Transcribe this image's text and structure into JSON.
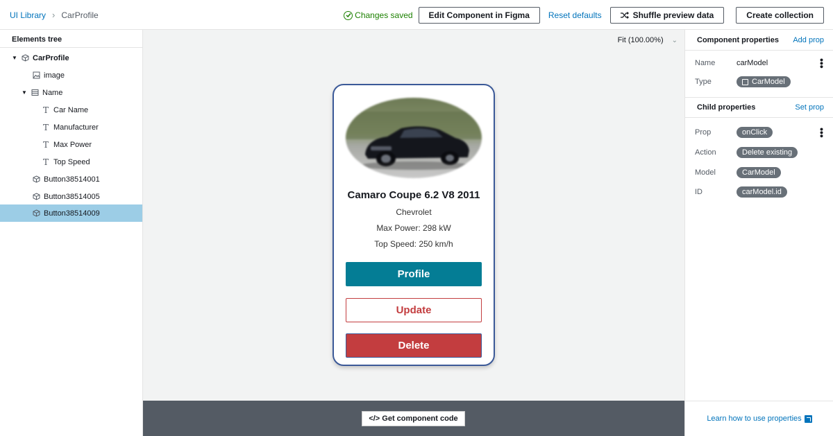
{
  "breadcrumb": {
    "root": "UI Library",
    "current": "CarProfile"
  },
  "toolbar": {
    "changes_saved": "Changes saved",
    "edit_figma": "Edit Component in Figma",
    "reset_defaults": "Reset defaults",
    "shuffle": "Shuffle preview data",
    "create_collection": "Create collection"
  },
  "tree": {
    "header": "Elements tree",
    "items": [
      {
        "label": "CarProfile"
      },
      {
        "label": "image"
      },
      {
        "label": "Name"
      },
      {
        "label": "Car Name"
      },
      {
        "label": "Manufacturer"
      },
      {
        "label": "Max Power"
      },
      {
        "label": "Top Speed"
      },
      {
        "label": "Button38514001"
      },
      {
        "label": "Button38514005"
      },
      {
        "label": "Button38514009"
      }
    ]
  },
  "canvas": {
    "zoom": "Fit (100.00%)",
    "card": {
      "title": "Camaro Coupe 6.2 V8 2011",
      "manufacturer": "Chevrolet",
      "max_power": "Max Power: 298 kW",
      "top_speed": "Top Speed: 250 km/h",
      "btn_profile": "Profile",
      "btn_update": "Update",
      "btn_delete": "Delete"
    },
    "get_code": "</> Get component code"
  },
  "component_props": {
    "title": "Component properties",
    "action": "Add prop",
    "name_label": "Name",
    "name_value": "carModel",
    "type_label": "Type",
    "type_value": "CarModel"
  },
  "child_props": {
    "title": "Child properties",
    "action": "Set prop",
    "rows": [
      {
        "label": "Prop",
        "value": "onClick"
      },
      {
        "label": "Action",
        "value": "Delete existing"
      },
      {
        "label": "Model",
        "value": "CarModel"
      },
      {
        "label": "ID",
        "value": "carModel.id"
      }
    ]
  },
  "footer": {
    "learn": "Learn how to use properties"
  },
  "colors": {
    "accent_link": "#0073bb",
    "saved_green": "#1d8102",
    "profile_button": "#047d95",
    "delete_button": "#c33d3f",
    "selected_row": "#9ccde6",
    "pill": "#687078"
  }
}
